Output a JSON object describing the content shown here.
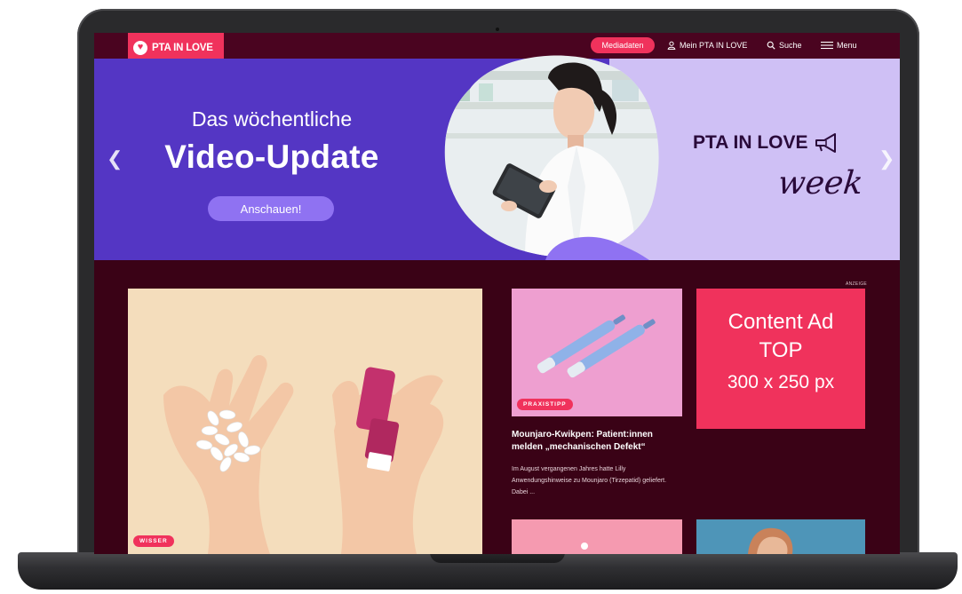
{
  "nav": {
    "logo_text": "PTA IN LOVE",
    "media_button": "Mediadaten",
    "my_account": "Mein PTA IN LOVE",
    "search": "Suche",
    "menu": "Menu"
  },
  "hero": {
    "subtitle": "Das wöchentliche",
    "title": "Video-Update",
    "button": "Anschauen!",
    "brand": "PTA IN LOVE",
    "brand_script": "week",
    "prev_icon": "chevron-left-icon",
    "next_icon": "chevron-right-icon"
  },
  "main_article": {
    "tag": "WISSER"
  },
  "card1": {
    "tag": "PRAXISTIPP",
    "title": "Mounjaro-Kwikpen: Patient:innen melden „mechanischen Defekt“",
    "text": "Im August vergangenen Jahres hatte Lilly Anwendungshinweise zu Mounjaro (Tirzepatid) geliefert. Dabei ..."
  },
  "ad": {
    "label": "ANZEIGE",
    "line1": "Content Ad",
    "line2": "TOP",
    "line3": "300 x 250 px"
  },
  "colors": {
    "accent": "#f0325c",
    "nav_bg": "#4a0420",
    "page_bg": "#3a0216",
    "hero_purple": "#5436c4",
    "hero_lilac": "#cfc0f5"
  }
}
